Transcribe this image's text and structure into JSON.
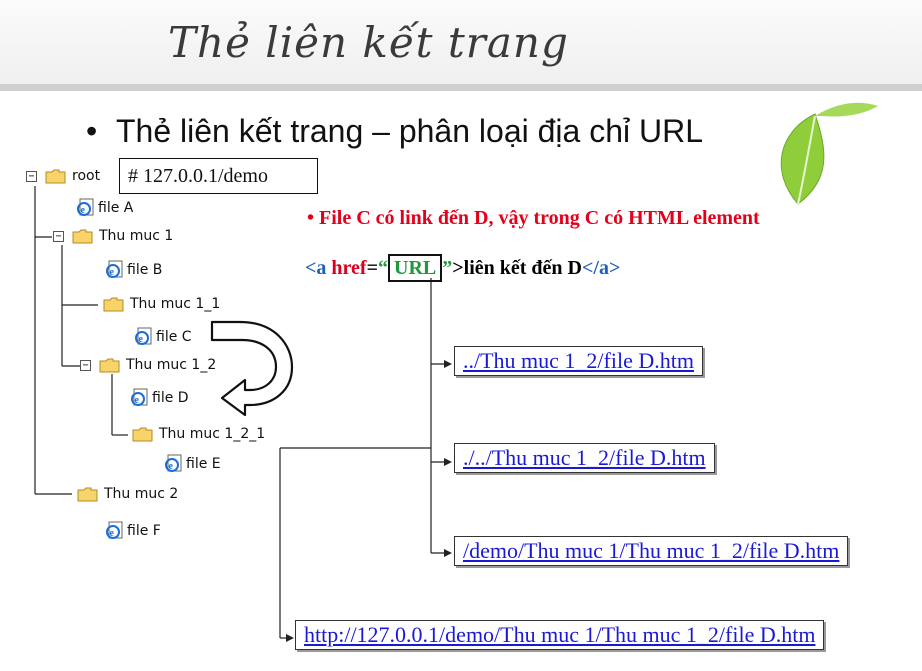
{
  "slide": {
    "title": "Thẻ liên kết trang",
    "bullet": "Thẻ liên kết trang – phân loại địa chỉ URL"
  },
  "tree": {
    "root_label": "root",
    "root_url": "# 127.0.0.1/demo",
    "items": [
      {
        "label": "file A"
      },
      {
        "label": "Thu muc 1"
      },
      {
        "label": "file B"
      },
      {
        "label": "Thu muc 1_1"
      },
      {
        "label": "file C"
      },
      {
        "label": "Thu muc 1_2"
      },
      {
        "label": "file D"
      },
      {
        "label": "Thu muc 1_2_1"
      },
      {
        "label": "file E"
      },
      {
        "label": "Thu muc 2"
      },
      {
        "label": "file F"
      }
    ]
  },
  "note": "• File C có link đến D, vậy trong C có HTML element",
  "code": {
    "open_a": "<a",
    "href": " href",
    "eq": "=",
    "q1": "“",
    "url": "URL",
    "q2": "”",
    "gt": ">",
    "text": "liên kết đến D",
    "close": "</a>"
  },
  "links": [
    "../Thu muc 1_2/file D.htm",
    "./../Thu muc 1_2/file D.htm",
    "/demo/Thu muc 1/Thu muc 1_2/file D.htm",
    "http://127.0.0.1/demo/Thu muc 1/Thu muc 1_2/file D.htm"
  ],
  "colors": {
    "note_red": "#e4001b",
    "tag_blue": "#1f5fc2",
    "url_green": "#1e9a3a",
    "link_blue": "#1a1ad6"
  },
  "icons": [
    "folder-icon",
    "ie-file-icon",
    "leaf-decoration",
    "curved-arrow-icon"
  ]
}
